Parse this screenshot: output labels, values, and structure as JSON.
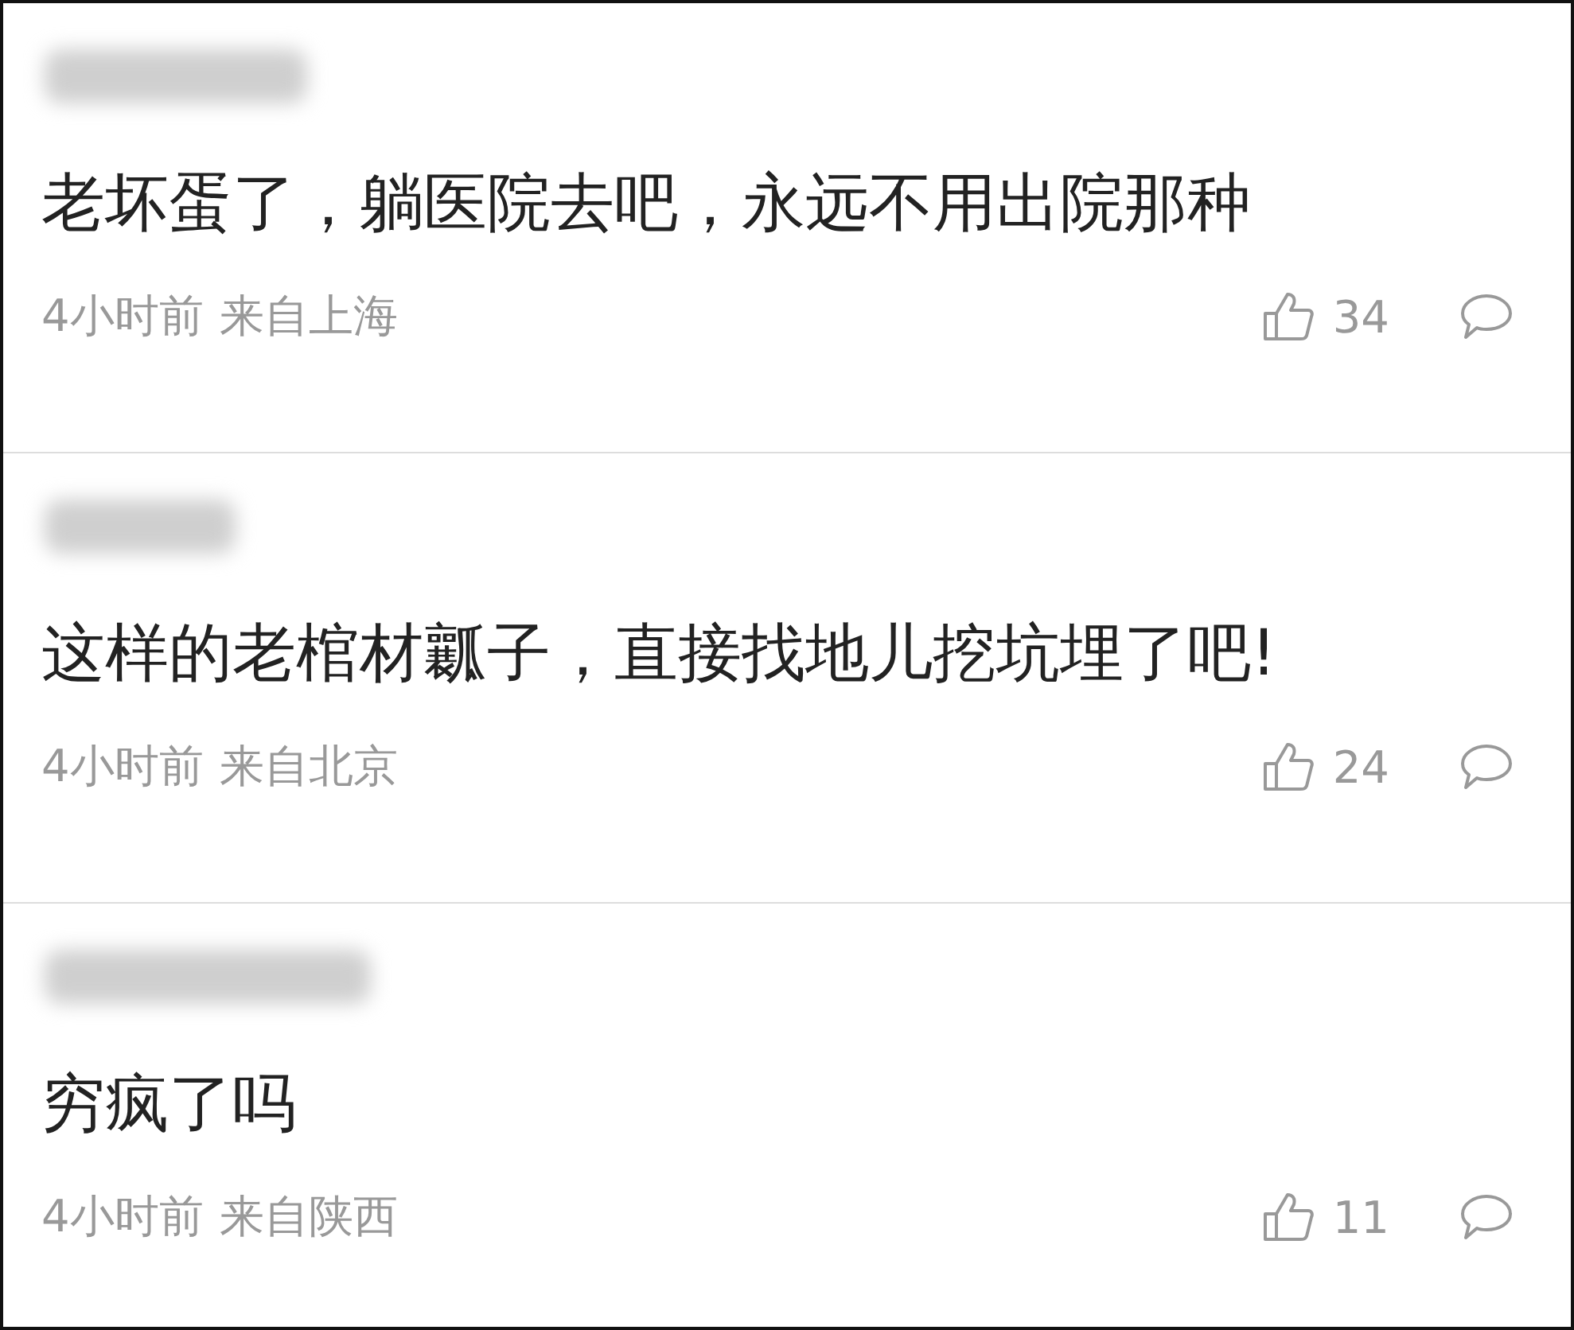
{
  "comments": [
    {
      "text": "老坏蛋了，躺医院去吧，永远不用出院那种",
      "time": "4小时前",
      "location": "来自上海",
      "likes": "34"
    },
    {
      "text": "这样的老棺材瓤子，直接找地儿挖坑埋了吧!",
      "time": "4小时前",
      "location": "来自北京",
      "likes": "24"
    },
    {
      "text": "穷疯了吗",
      "time": "4小时前",
      "location": "来自陕西",
      "likes": "11"
    }
  ]
}
